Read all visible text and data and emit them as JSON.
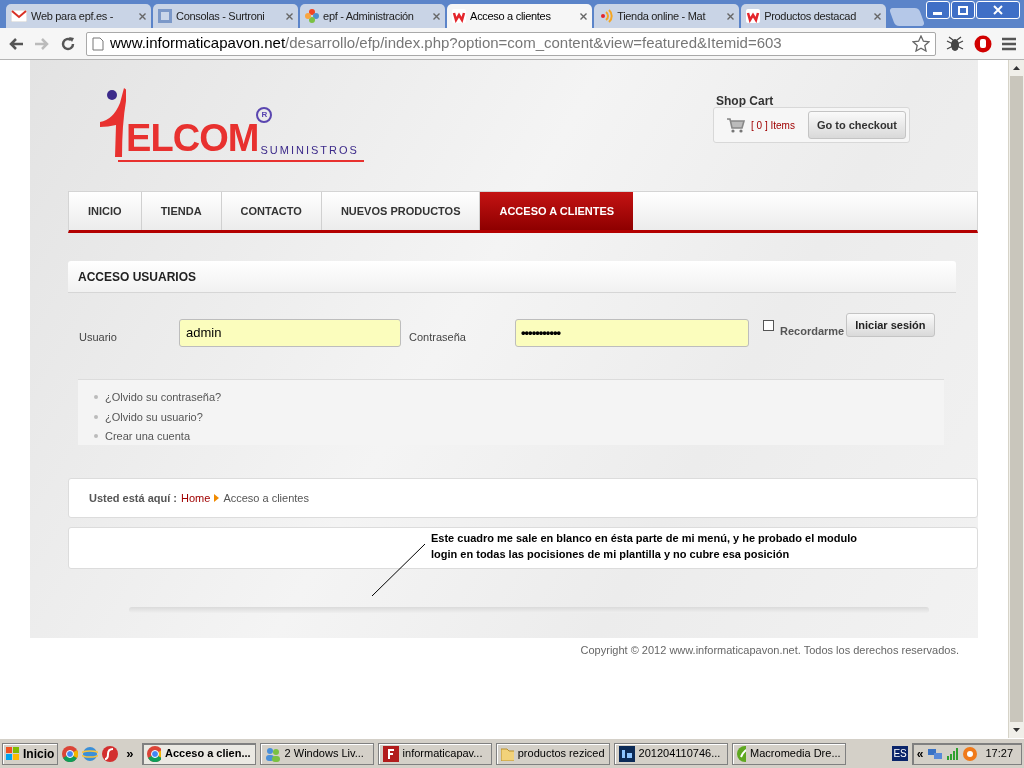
{
  "browser": {
    "tabs": [
      {
        "title": "Web para epf.es -",
        "kind": "mail",
        "selected": false
      },
      {
        "title": "Consolas - Surtroni",
        "kind": "site",
        "selected": false
      },
      {
        "title": "epf - Administración",
        "kind": "joomla",
        "selected": false
      },
      {
        "title": "Acceso a clientes",
        "kind": "shop",
        "selected": true
      },
      {
        "title": "Tienda online - Mat",
        "kind": "feed",
        "selected": false
      },
      {
        "title": "Productos destacad",
        "kind": "shop",
        "selected": false
      }
    ],
    "address": {
      "host": "www.informaticapavon.net",
      "path": "/desarrollo/efp/index.php?option=com_content&view=featured&Itemid=603"
    }
  },
  "logo": {
    "brand": "ELCOM",
    "registered": "R",
    "tagline": "SUMINISTROS"
  },
  "cart": {
    "title": "Shop Cart",
    "count": "[ 0 ] Items",
    "button": "Go to checkout"
  },
  "nav": [
    {
      "label": "INICIO",
      "selected": false
    },
    {
      "label": "TIENDA",
      "selected": false
    },
    {
      "label": "CONTACTO",
      "selected": false
    },
    {
      "label": "NUEVOS PRODUCTOS",
      "selected": false
    },
    {
      "label": "ACCESO A CLIENTES",
      "selected": true
    }
  ],
  "login": {
    "title": "ACCESO USUARIOS",
    "user_label": "Usuario",
    "user_value": "admin",
    "password_label": "Contraseña",
    "password_value": "•••••••••••",
    "remember_label": "Recordarme",
    "remember_checked": false,
    "submit": "Iniciar sesión",
    "links": [
      "¿Olvido su contraseña?",
      "¿Olvido su usuario?",
      "Crear una cuenta"
    ]
  },
  "breadcrumb": {
    "label": "Usted está aquí :",
    "items": [
      {
        "text": "Home",
        "kind": "link"
      },
      {
        "text": "Acceso a clientes",
        "kind": "current"
      }
    ]
  },
  "annotation": "Este cuadro me sale en blanco en ésta parte de mi menú, y he probado el modulo login en todas las pocisiones de mi plantilla y no cubre esa posición",
  "footer": "Copyright © 2012 www.informaticapavon.net. Todos los derechos reservados.",
  "taskbar": {
    "start": "Inicio",
    "tasks": [
      {
        "title": "Acceso a clien...",
        "kind": "chrome",
        "selected": true
      },
      {
        "title": "2 Windows Liv...",
        "kind": "people",
        "selected": false
      },
      {
        "title": "informaticapav...",
        "kind": "ftp",
        "selected": false
      },
      {
        "title": "productos reziced",
        "kind": "folder",
        "selected": false
      },
      {
        "title": "201204110746...",
        "kind": "ps",
        "selected": false
      },
      {
        "title": "Macromedia Dre...",
        "kind": "dw",
        "selected": false
      }
    ],
    "language": "ES",
    "overflow": "«",
    "more": "»",
    "time": "17:27"
  }
}
